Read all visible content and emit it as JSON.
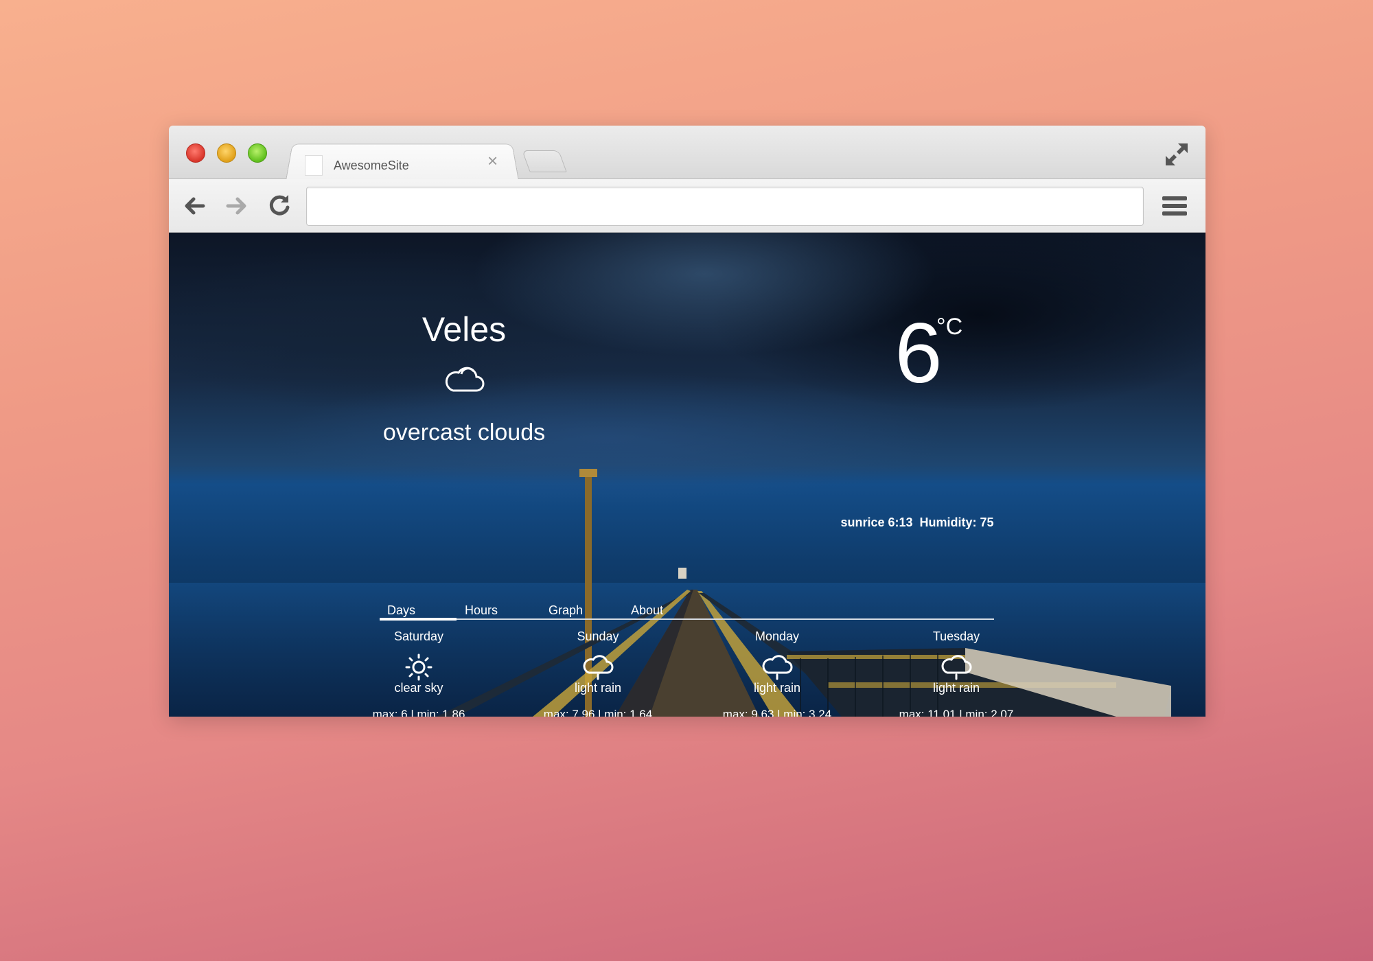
{
  "browser": {
    "tab_title": "AwesomeSite",
    "tab_close": "×",
    "url": ""
  },
  "current": {
    "city": "Veles",
    "icon": "cloud-icon",
    "description": "overcast clouds",
    "temperature": "6",
    "unit": "°C",
    "sunrise": "sunrice 6:13",
    "humidity": "Humidity: 75"
  },
  "tabs": [
    {
      "label": "Days",
      "active": true
    },
    {
      "label": "Hours",
      "active": false
    },
    {
      "label": "Graph",
      "active": false
    },
    {
      "label": "About",
      "active": false
    }
  ],
  "forecast": [
    {
      "day": "Saturday",
      "icon": "sun-icon",
      "desc": "clear sky",
      "minmax": "max: 6 | min: 1.86"
    },
    {
      "day": "Sunday",
      "icon": "rain-cloud-icon",
      "desc": "light rain",
      "minmax": "max: 7.96 | min: 1.64"
    },
    {
      "day": "Monday",
      "icon": "rain-cloud-icon",
      "desc": "light rain",
      "minmax": "max: 9.63 | min: 3.24"
    },
    {
      "day": "Tuesday",
      "icon": "rain-cloud-icon",
      "desc": "light rain",
      "minmax": "max: 11.01 | min: 2.07"
    }
  ],
  "colors": {
    "background_top": "#f8b08e",
    "background_bottom": "#c96479",
    "text": "#ffffff"
  }
}
